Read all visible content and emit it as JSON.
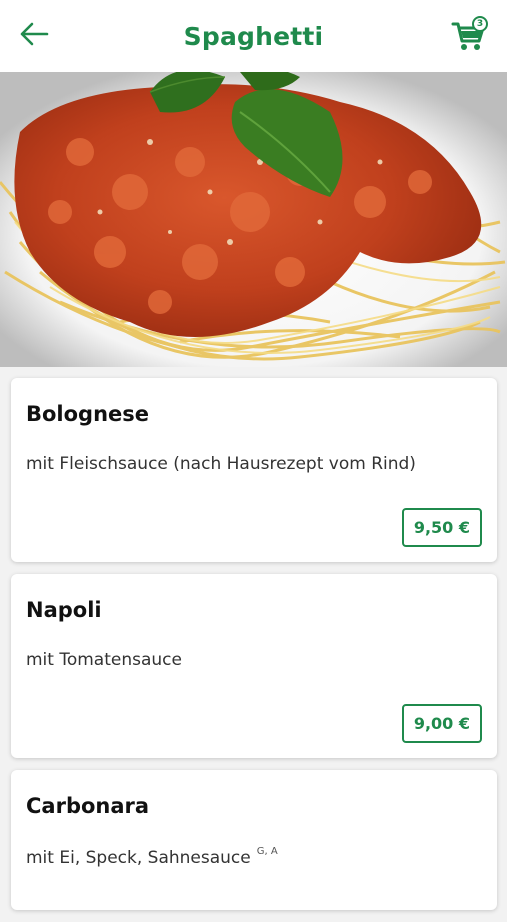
{
  "header": {
    "title": "Spaghetti",
    "cart_count": "3"
  },
  "colors": {
    "accent": "#1f8a4c"
  },
  "items": [
    {
      "name": "Bolognese",
      "description": "mit Fleischsauce (nach Hausrezept vom Rind)",
      "allergens": "",
      "price": "9,50 €"
    },
    {
      "name": "Napoli",
      "description": "mit Tomatensauce",
      "allergens": "",
      "price": "9,00 €"
    },
    {
      "name": "Carbonara",
      "description": "mit Ei, Speck, Sahnesauce",
      "allergens": "G, A",
      "price": ""
    }
  ]
}
